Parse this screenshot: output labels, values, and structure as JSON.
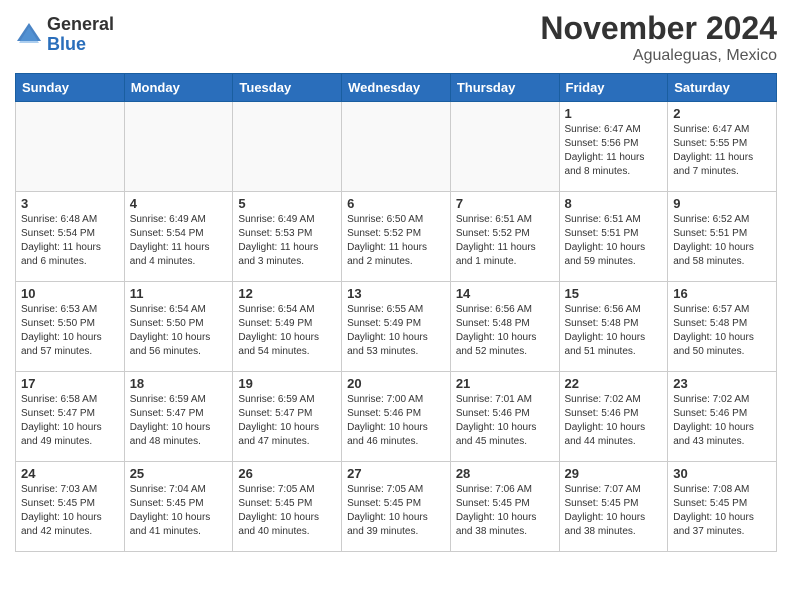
{
  "logo": {
    "general": "General",
    "blue": "Blue"
  },
  "header": {
    "month": "November 2024",
    "location": "Agualeguas, Mexico"
  },
  "weekdays": [
    "Sunday",
    "Monday",
    "Tuesday",
    "Wednesday",
    "Thursday",
    "Friday",
    "Saturday"
  ],
  "weeks": [
    [
      {
        "day": "",
        "info": ""
      },
      {
        "day": "",
        "info": ""
      },
      {
        "day": "",
        "info": ""
      },
      {
        "day": "",
        "info": ""
      },
      {
        "day": "",
        "info": ""
      },
      {
        "day": "1",
        "info": "Sunrise: 6:47 AM\nSunset: 5:56 PM\nDaylight: 11 hours\nand 8 minutes."
      },
      {
        "day": "2",
        "info": "Sunrise: 6:47 AM\nSunset: 5:55 PM\nDaylight: 11 hours\nand 7 minutes."
      }
    ],
    [
      {
        "day": "3",
        "info": "Sunrise: 6:48 AM\nSunset: 5:54 PM\nDaylight: 11 hours\nand 6 minutes."
      },
      {
        "day": "4",
        "info": "Sunrise: 6:49 AM\nSunset: 5:54 PM\nDaylight: 11 hours\nand 4 minutes."
      },
      {
        "day": "5",
        "info": "Sunrise: 6:49 AM\nSunset: 5:53 PM\nDaylight: 11 hours\nand 3 minutes."
      },
      {
        "day": "6",
        "info": "Sunrise: 6:50 AM\nSunset: 5:52 PM\nDaylight: 11 hours\nand 2 minutes."
      },
      {
        "day": "7",
        "info": "Sunrise: 6:51 AM\nSunset: 5:52 PM\nDaylight: 11 hours\nand 1 minute."
      },
      {
        "day": "8",
        "info": "Sunrise: 6:51 AM\nSunset: 5:51 PM\nDaylight: 10 hours\nand 59 minutes."
      },
      {
        "day": "9",
        "info": "Sunrise: 6:52 AM\nSunset: 5:51 PM\nDaylight: 10 hours\nand 58 minutes."
      }
    ],
    [
      {
        "day": "10",
        "info": "Sunrise: 6:53 AM\nSunset: 5:50 PM\nDaylight: 10 hours\nand 57 minutes."
      },
      {
        "day": "11",
        "info": "Sunrise: 6:54 AM\nSunset: 5:50 PM\nDaylight: 10 hours\nand 56 minutes."
      },
      {
        "day": "12",
        "info": "Sunrise: 6:54 AM\nSunset: 5:49 PM\nDaylight: 10 hours\nand 54 minutes."
      },
      {
        "day": "13",
        "info": "Sunrise: 6:55 AM\nSunset: 5:49 PM\nDaylight: 10 hours\nand 53 minutes."
      },
      {
        "day": "14",
        "info": "Sunrise: 6:56 AM\nSunset: 5:48 PM\nDaylight: 10 hours\nand 52 minutes."
      },
      {
        "day": "15",
        "info": "Sunrise: 6:56 AM\nSunset: 5:48 PM\nDaylight: 10 hours\nand 51 minutes."
      },
      {
        "day": "16",
        "info": "Sunrise: 6:57 AM\nSunset: 5:48 PM\nDaylight: 10 hours\nand 50 minutes."
      }
    ],
    [
      {
        "day": "17",
        "info": "Sunrise: 6:58 AM\nSunset: 5:47 PM\nDaylight: 10 hours\nand 49 minutes."
      },
      {
        "day": "18",
        "info": "Sunrise: 6:59 AM\nSunset: 5:47 PM\nDaylight: 10 hours\nand 48 minutes."
      },
      {
        "day": "19",
        "info": "Sunrise: 6:59 AM\nSunset: 5:47 PM\nDaylight: 10 hours\nand 47 minutes."
      },
      {
        "day": "20",
        "info": "Sunrise: 7:00 AM\nSunset: 5:46 PM\nDaylight: 10 hours\nand 46 minutes."
      },
      {
        "day": "21",
        "info": "Sunrise: 7:01 AM\nSunset: 5:46 PM\nDaylight: 10 hours\nand 45 minutes."
      },
      {
        "day": "22",
        "info": "Sunrise: 7:02 AM\nSunset: 5:46 PM\nDaylight: 10 hours\nand 44 minutes."
      },
      {
        "day": "23",
        "info": "Sunrise: 7:02 AM\nSunset: 5:46 PM\nDaylight: 10 hours\nand 43 minutes."
      }
    ],
    [
      {
        "day": "24",
        "info": "Sunrise: 7:03 AM\nSunset: 5:45 PM\nDaylight: 10 hours\nand 42 minutes."
      },
      {
        "day": "25",
        "info": "Sunrise: 7:04 AM\nSunset: 5:45 PM\nDaylight: 10 hours\nand 41 minutes."
      },
      {
        "day": "26",
        "info": "Sunrise: 7:05 AM\nSunset: 5:45 PM\nDaylight: 10 hours\nand 40 minutes."
      },
      {
        "day": "27",
        "info": "Sunrise: 7:05 AM\nSunset: 5:45 PM\nDaylight: 10 hours\nand 39 minutes."
      },
      {
        "day": "28",
        "info": "Sunrise: 7:06 AM\nSunset: 5:45 PM\nDaylight: 10 hours\nand 38 minutes."
      },
      {
        "day": "29",
        "info": "Sunrise: 7:07 AM\nSunset: 5:45 PM\nDaylight: 10 hours\nand 38 minutes."
      },
      {
        "day": "30",
        "info": "Sunrise: 7:08 AM\nSunset: 5:45 PM\nDaylight: 10 hours\nand 37 minutes."
      }
    ]
  ]
}
